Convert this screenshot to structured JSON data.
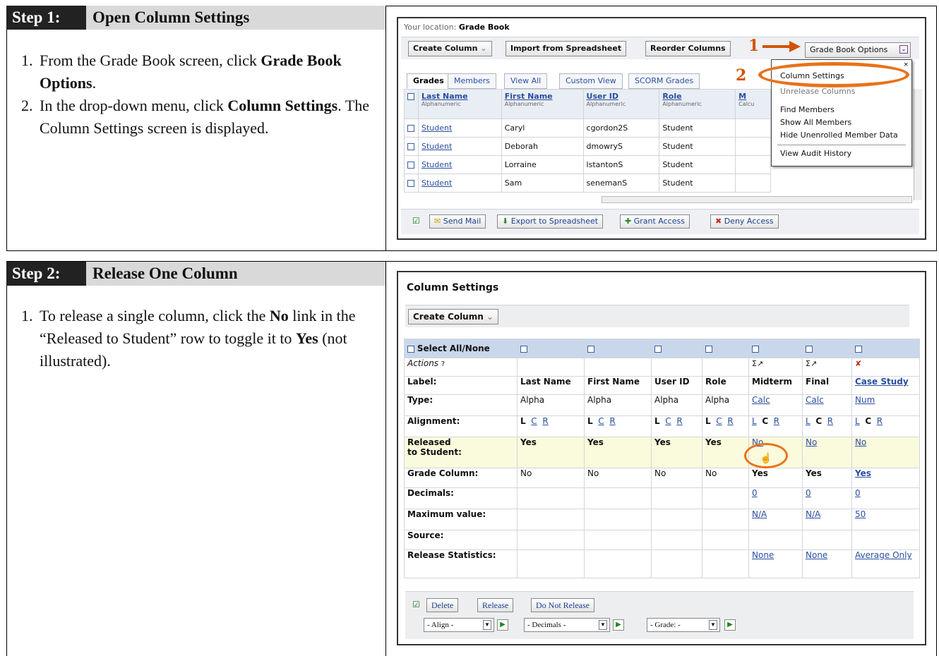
{
  "step1": {
    "number": "Step 1:",
    "title": "Open Column Settings",
    "instructions": [
      {
        "n": "1.",
        "a": "From the Grade Book screen, click ",
        "b": "Grade Book Options",
        "c": "."
      },
      {
        "n": "2.",
        "a": "In the drop-down menu, click ",
        "b": "Column Settings",
        "c": ". The Column Settings screen is displayed."
      }
    ],
    "screenshot": {
      "location_prefix": "Your location: ",
      "location": "Grade Book",
      "buttons": [
        "Create Column",
        "Import from Spreadsheet",
        "Reorder Columns"
      ],
      "options_button": "Grade Book Options",
      "callouts": [
        "1",
        "2"
      ],
      "tabs": [
        "Grades",
        "Members",
        "View All",
        "Custom View",
        "SCORM Grades"
      ],
      "columns": [
        {
          "name": "Last Name",
          "sub": "Alphanumeric"
        },
        {
          "name": "First Name",
          "sub": "Alphanumeric"
        },
        {
          "name": "User ID",
          "sub": "Alphanumeric"
        },
        {
          "name": "Role",
          "sub": "Alphanumeric"
        },
        {
          "name": "M",
          "sub": "Calcu"
        }
      ],
      "rows": [
        {
          "last": "Student",
          "first": "Caryl",
          "uid": "cgordon2S",
          "role": "Student"
        },
        {
          "last": "Student",
          "first": "Deborah",
          "uid": "dmowryS",
          "role": "Student"
        },
        {
          "last": "Student",
          "first": "Lorraine",
          "uid": "lstantonS",
          "role": "Student"
        },
        {
          "last": "Student",
          "first": "Sam",
          "uid": "senemanS",
          "role": "Student"
        }
      ],
      "menu": [
        "Column Settings",
        "Unrelease Columns",
        "Find Members",
        "Show All Members",
        "Hide Unenrolled Member Data",
        "View Audit History"
      ],
      "bottom_buttons": [
        "Send Mail",
        "Export to Spreadsheet",
        "Grant Access",
        "Deny Access"
      ]
    }
  },
  "step2": {
    "number": "Step 2:",
    "title": "Release One Column",
    "instruction": {
      "n": "1.",
      "a": "To release a single column, click the ",
      "b": "No",
      "c": " link in the “Released to Student” row to toggle it to ",
      "d": "Yes",
      "e": " (not illustrated)."
    },
    "screenshot": {
      "title": "Column Settings",
      "create_button": "Create Column",
      "select_all": "Select All/None",
      "row_labels": {
        "actions": "Actions",
        "label": "Label:",
        "type": "Type:",
        "alignment": "Alignment:",
        "released_1": "Released",
        "released_2": "to Student:",
        "grade_column": "Grade Column:",
        "decimals": "Decimals:",
        "maximum": "Maximum value:",
        "source": "Source:",
        "release_stats": "Release Statistics:"
      },
      "columns": [
        {
          "label": "Last Name",
          "type": "Alpha",
          "released": "Yes",
          "grade": "No",
          "decimals": "",
          "max": "",
          "stats": ""
        },
        {
          "label": "First Name",
          "type": "Alpha",
          "released": "Yes",
          "grade": "No",
          "decimals": "",
          "max": "",
          "stats": ""
        },
        {
          "label": "User ID",
          "type": "Alpha",
          "released": "Yes",
          "grade": "No",
          "decimals": "",
          "max": "",
          "stats": ""
        },
        {
          "label": "Role",
          "type": "Alpha",
          "released": "Yes",
          "grade": "No",
          "decimals": "",
          "max": "",
          "stats": ""
        },
        {
          "label": "Midterm",
          "type": "Calc",
          "released": "No",
          "grade": "Yes",
          "decimals": "0",
          "max": "N/A",
          "stats": "None"
        },
        {
          "label": "Final",
          "type": "Calc",
          "released": "No",
          "grade": "Yes",
          "decimals": "0",
          "max": "N/A",
          "stats": "None"
        },
        {
          "label": "Case Study",
          "type": "Num",
          "released": "No",
          "grade": "Yes",
          "decimals": "0",
          "max": "50",
          "stats": "Average Only"
        }
      ],
      "align_letters": [
        "L",
        "C",
        "R"
      ],
      "footer_buttons": [
        "Delete",
        "Release",
        "Do Not Release"
      ],
      "selects": [
        "- Align -",
        "- Decimals -",
        "- Grade: -"
      ]
    }
  },
  "colors": {
    "highlight": "#e8721c",
    "link": "#2a4fa0",
    "header_bar": "#d9d9d9"
  }
}
